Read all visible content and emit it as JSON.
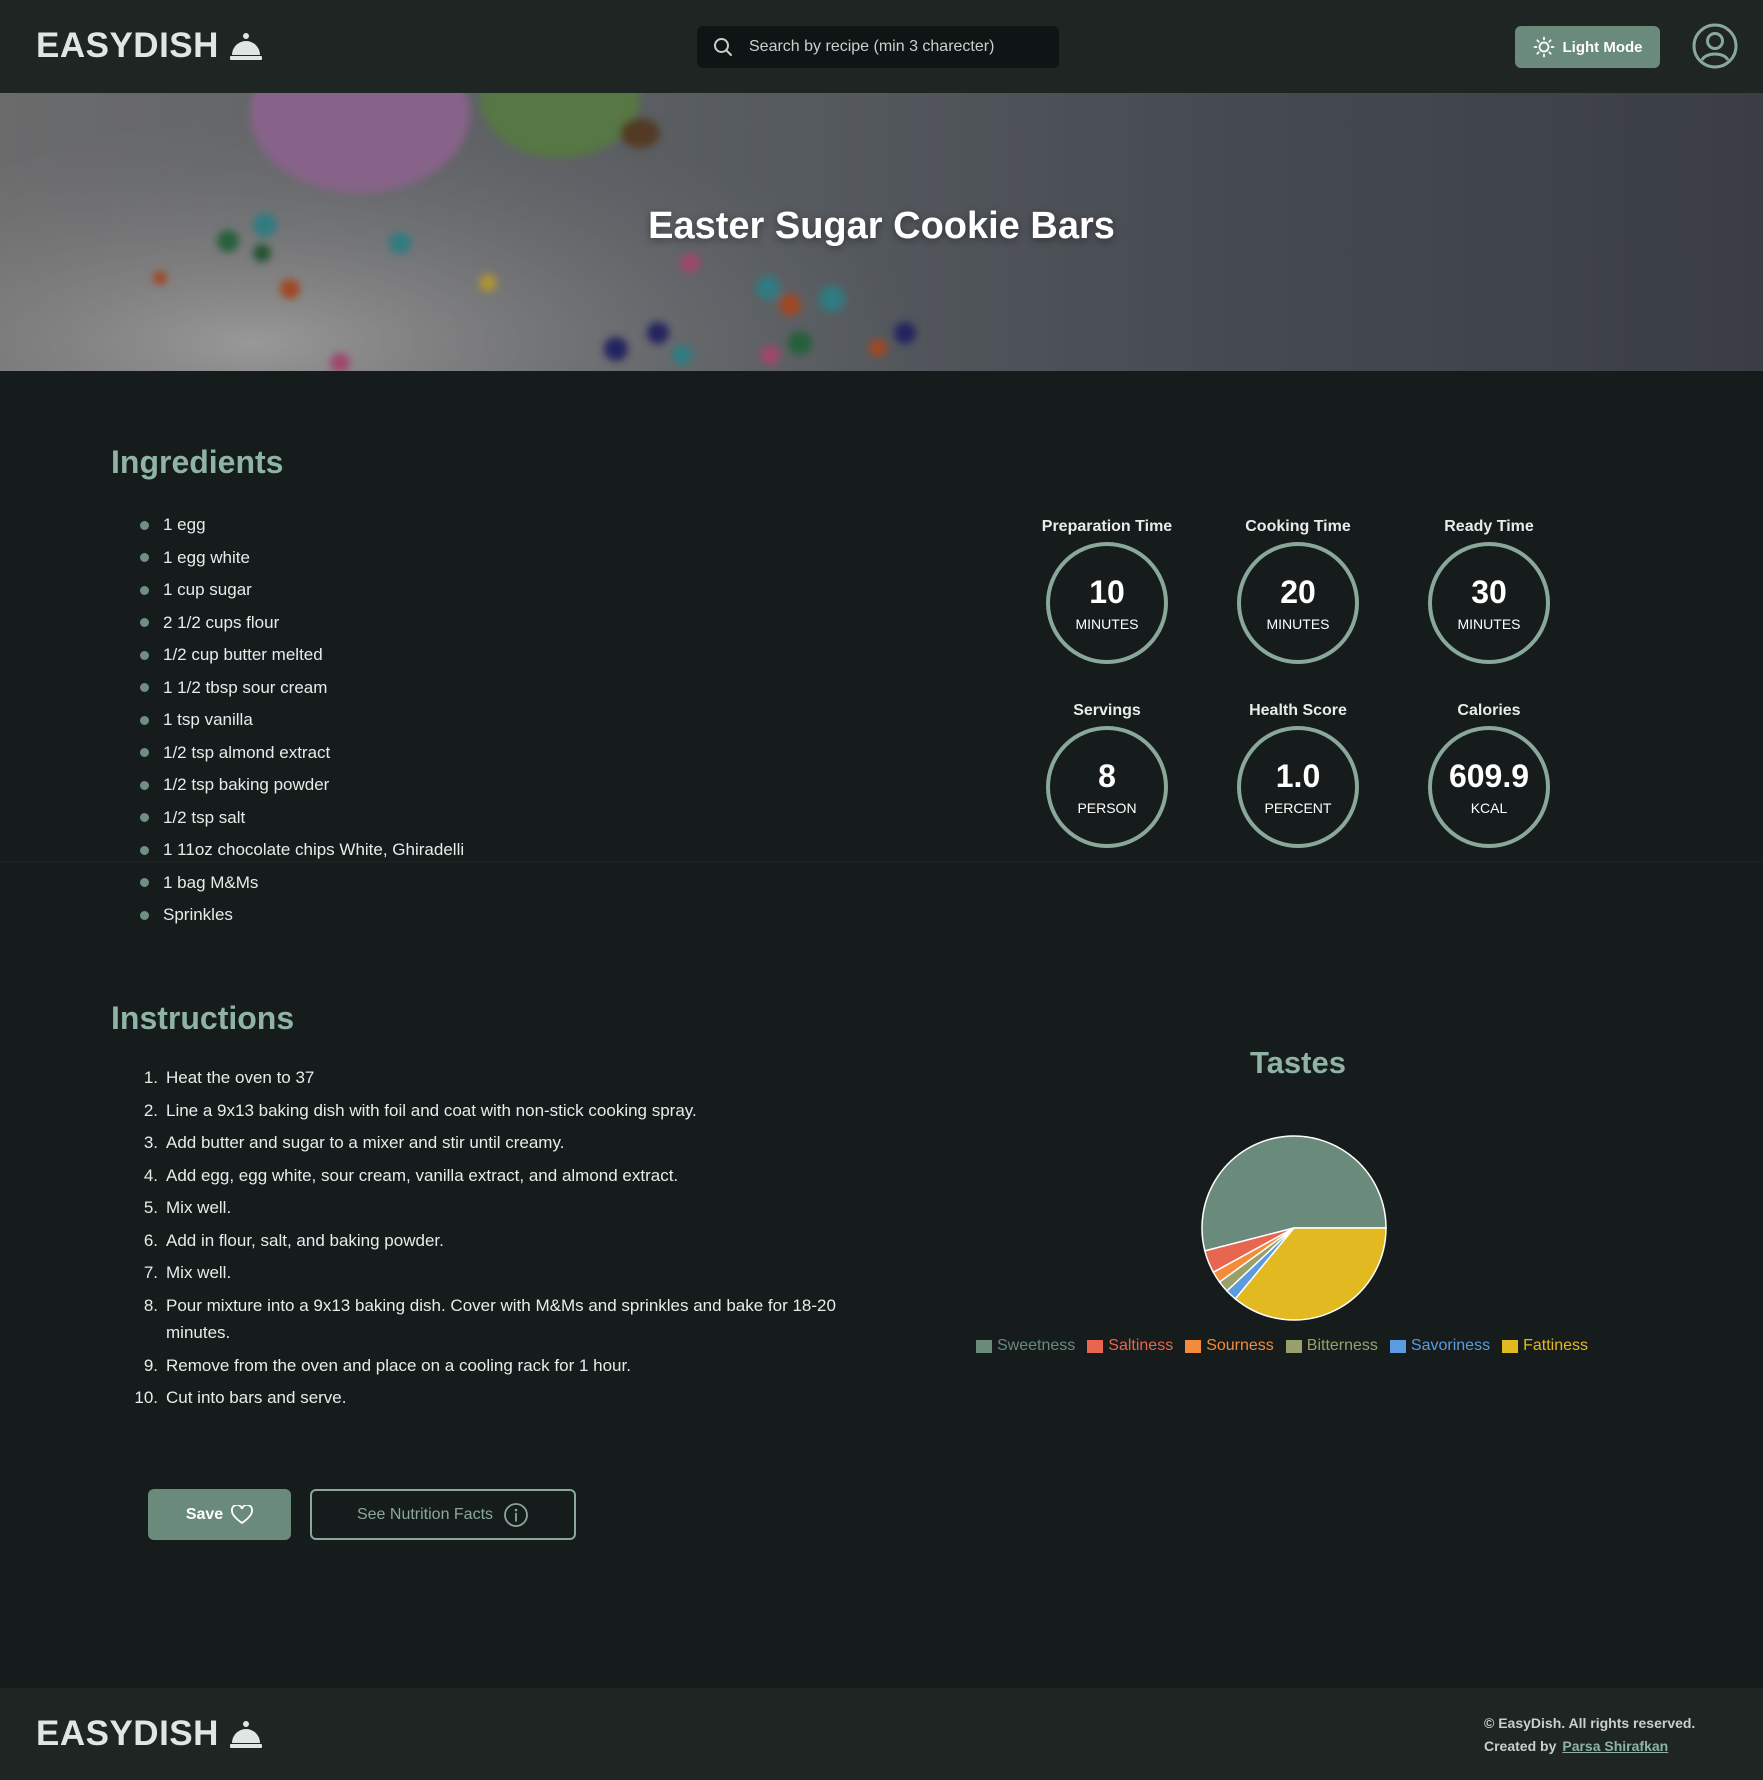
{
  "header": {
    "brand": "EASYDISH",
    "search_placeholder": "Search by recipe (min 3 charecter)",
    "light_mode_label": "Light Mode"
  },
  "recipe": {
    "title": "Easter Sugar Cookie Bars"
  },
  "ingredients": {
    "title": "Ingredients",
    "items": [
      "1 egg",
      "1 egg white",
      "1 cup sugar",
      "2 1/2 cups flour",
      "1/2 cup butter melted",
      "1 1/2 tbsp sour cream",
      "1 tsp vanilla",
      "1/2 tsp almond extract",
      "1/2 tsp baking powder",
      "1/2 tsp salt",
      "1 11oz chocolate chips White, Ghiradelli",
      "1 bag M&Ms",
      "Sprinkles"
    ]
  },
  "stats": [
    {
      "label": "Preparation Time",
      "value": "10",
      "unit": "MINUTES"
    },
    {
      "label": "Cooking Time",
      "value": "20",
      "unit": "MINUTES"
    },
    {
      "label": "Ready Time",
      "value": "30",
      "unit": "MINUTES"
    },
    {
      "label": "Servings",
      "value": "8",
      "unit": "PERSON"
    },
    {
      "label": "Health Score",
      "value": "1.0",
      "unit": "PERCENT"
    },
    {
      "label": "Calories",
      "value": "609.9",
      "unit": "KCAL"
    }
  ],
  "instructions": {
    "title": "Instructions",
    "steps": [
      "Heat the oven to 37",
      "Line a 9x13 baking dish with foil and coat with non-stick cooking spray.",
      "Add butter and sugar to a mixer and stir until creamy.",
      "Add egg, egg white, sour cream, vanilla extract, and almond extract.",
      "Mix well.",
      "Add in flour, salt, and baking powder.",
      "Mix well.",
      "Pour mixture into a 9x13 baking dish. Cover with M&Ms and sprinkles and bake for 18-20 minutes.",
      "Remove from the oven and place on a cooling rack for 1 hour.",
      "Cut into bars and serve."
    ]
  },
  "tastes": {
    "title": "Tastes"
  },
  "chart_data": {
    "type": "pie",
    "categories": [
      "Sweetness",
      "Saltiness",
      "Sourness",
      "Bitterness",
      "Savoriness",
      "Fattiness"
    ],
    "values": [
      54,
      4,
      2,
      2,
      2,
      36
    ],
    "colors": [
      "#6a8a7c",
      "#e8664f",
      "#f28c3c",
      "#9aa06c",
      "#5b9be0",
      "#e2b920"
    ],
    "legend_position": "bottom"
  },
  "actions": {
    "save_label": "Save",
    "nutrition_label": "See Nutrition Facts"
  },
  "footer": {
    "brand": "EASYDISH",
    "copyright": "© EasyDish. All rights reserved.",
    "created_by": "Created by",
    "author": "Parsa Shirafkan"
  }
}
